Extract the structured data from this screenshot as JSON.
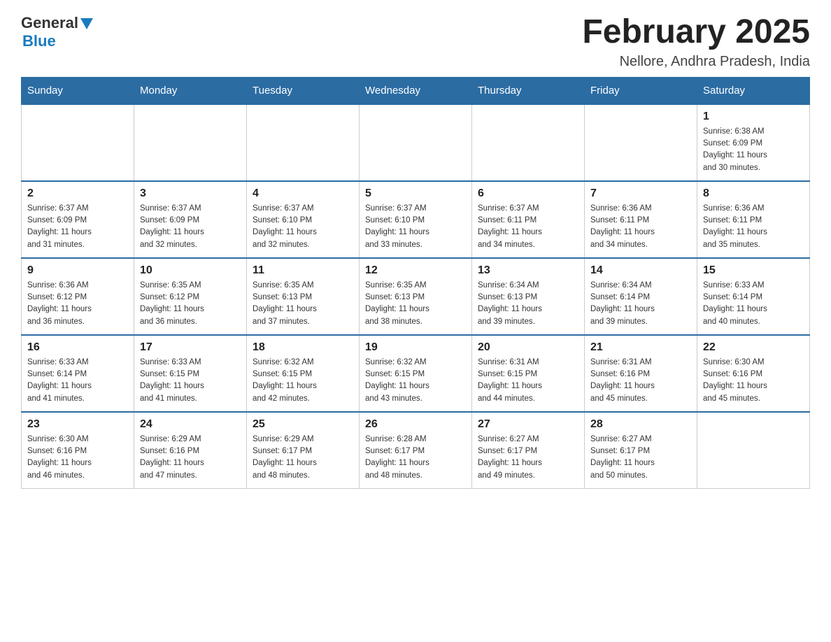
{
  "header": {
    "logo_general": "General",
    "logo_blue": "Blue",
    "title": "February 2025",
    "subtitle": "Nellore, Andhra Pradesh, India"
  },
  "weekdays": [
    "Sunday",
    "Monday",
    "Tuesday",
    "Wednesday",
    "Thursday",
    "Friday",
    "Saturday"
  ],
  "weeks": [
    [
      {
        "day": "",
        "info": ""
      },
      {
        "day": "",
        "info": ""
      },
      {
        "day": "",
        "info": ""
      },
      {
        "day": "",
        "info": ""
      },
      {
        "day": "",
        "info": ""
      },
      {
        "day": "",
        "info": ""
      },
      {
        "day": "1",
        "info": "Sunrise: 6:38 AM\nSunset: 6:09 PM\nDaylight: 11 hours\nand 30 minutes."
      }
    ],
    [
      {
        "day": "2",
        "info": "Sunrise: 6:37 AM\nSunset: 6:09 PM\nDaylight: 11 hours\nand 31 minutes."
      },
      {
        "day": "3",
        "info": "Sunrise: 6:37 AM\nSunset: 6:09 PM\nDaylight: 11 hours\nand 32 minutes."
      },
      {
        "day": "4",
        "info": "Sunrise: 6:37 AM\nSunset: 6:10 PM\nDaylight: 11 hours\nand 32 minutes."
      },
      {
        "day": "5",
        "info": "Sunrise: 6:37 AM\nSunset: 6:10 PM\nDaylight: 11 hours\nand 33 minutes."
      },
      {
        "day": "6",
        "info": "Sunrise: 6:37 AM\nSunset: 6:11 PM\nDaylight: 11 hours\nand 34 minutes."
      },
      {
        "day": "7",
        "info": "Sunrise: 6:36 AM\nSunset: 6:11 PM\nDaylight: 11 hours\nand 34 minutes."
      },
      {
        "day": "8",
        "info": "Sunrise: 6:36 AM\nSunset: 6:11 PM\nDaylight: 11 hours\nand 35 minutes."
      }
    ],
    [
      {
        "day": "9",
        "info": "Sunrise: 6:36 AM\nSunset: 6:12 PM\nDaylight: 11 hours\nand 36 minutes."
      },
      {
        "day": "10",
        "info": "Sunrise: 6:35 AM\nSunset: 6:12 PM\nDaylight: 11 hours\nand 36 minutes."
      },
      {
        "day": "11",
        "info": "Sunrise: 6:35 AM\nSunset: 6:13 PM\nDaylight: 11 hours\nand 37 minutes."
      },
      {
        "day": "12",
        "info": "Sunrise: 6:35 AM\nSunset: 6:13 PM\nDaylight: 11 hours\nand 38 minutes."
      },
      {
        "day": "13",
        "info": "Sunrise: 6:34 AM\nSunset: 6:13 PM\nDaylight: 11 hours\nand 39 minutes."
      },
      {
        "day": "14",
        "info": "Sunrise: 6:34 AM\nSunset: 6:14 PM\nDaylight: 11 hours\nand 39 minutes."
      },
      {
        "day": "15",
        "info": "Sunrise: 6:33 AM\nSunset: 6:14 PM\nDaylight: 11 hours\nand 40 minutes."
      }
    ],
    [
      {
        "day": "16",
        "info": "Sunrise: 6:33 AM\nSunset: 6:14 PM\nDaylight: 11 hours\nand 41 minutes."
      },
      {
        "day": "17",
        "info": "Sunrise: 6:33 AM\nSunset: 6:15 PM\nDaylight: 11 hours\nand 41 minutes."
      },
      {
        "day": "18",
        "info": "Sunrise: 6:32 AM\nSunset: 6:15 PM\nDaylight: 11 hours\nand 42 minutes."
      },
      {
        "day": "19",
        "info": "Sunrise: 6:32 AM\nSunset: 6:15 PM\nDaylight: 11 hours\nand 43 minutes."
      },
      {
        "day": "20",
        "info": "Sunrise: 6:31 AM\nSunset: 6:15 PM\nDaylight: 11 hours\nand 44 minutes."
      },
      {
        "day": "21",
        "info": "Sunrise: 6:31 AM\nSunset: 6:16 PM\nDaylight: 11 hours\nand 45 minutes."
      },
      {
        "day": "22",
        "info": "Sunrise: 6:30 AM\nSunset: 6:16 PM\nDaylight: 11 hours\nand 45 minutes."
      }
    ],
    [
      {
        "day": "23",
        "info": "Sunrise: 6:30 AM\nSunset: 6:16 PM\nDaylight: 11 hours\nand 46 minutes."
      },
      {
        "day": "24",
        "info": "Sunrise: 6:29 AM\nSunset: 6:16 PM\nDaylight: 11 hours\nand 47 minutes."
      },
      {
        "day": "25",
        "info": "Sunrise: 6:29 AM\nSunset: 6:17 PM\nDaylight: 11 hours\nand 48 minutes."
      },
      {
        "day": "26",
        "info": "Sunrise: 6:28 AM\nSunset: 6:17 PM\nDaylight: 11 hours\nand 48 minutes."
      },
      {
        "day": "27",
        "info": "Sunrise: 6:27 AM\nSunset: 6:17 PM\nDaylight: 11 hours\nand 49 minutes."
      },
      {
        "day": "28",
        "info": "Sunrise: 6:27 AM\nSunset: 6:17 PM\nDaylight: 11 hours\nand 50 minutes."
      },
      {
        "day": "",
        "info": ""
      }
    ]
  ]
}
